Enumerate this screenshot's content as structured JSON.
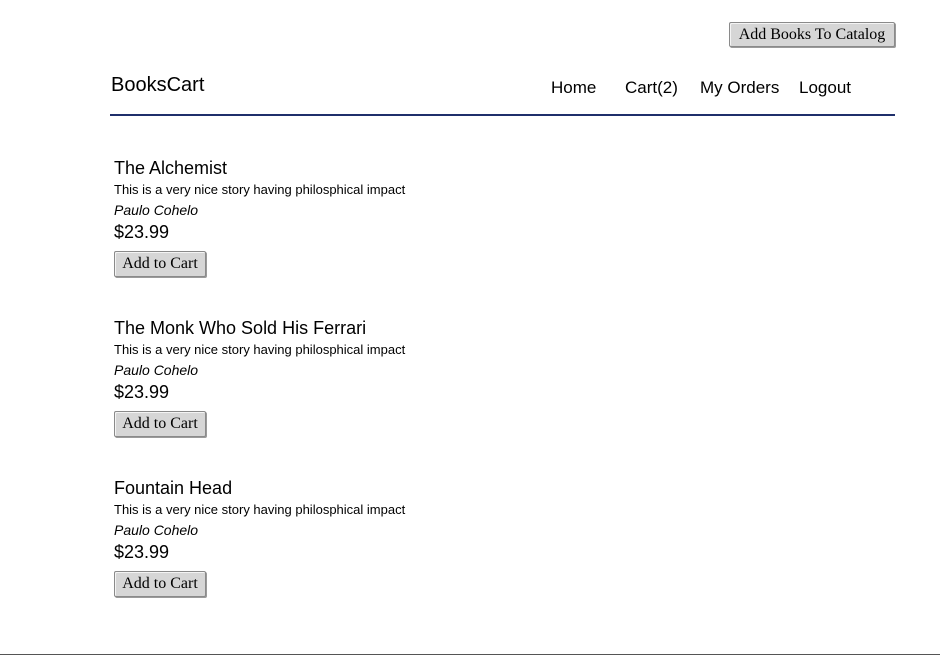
{
  "admin": {
    "add_books_label": "Add Books To Catalog"
  },
  "header": {
    "brand": "BooksCart",
    "nav": {
      "home": "Home",
      "cart": "Cart(2)",
      "orders": "My Orders",
      "logout": "Logout"
    }
  },
  "books": [
    {
      "title": "The Alchemist",
      "description": "This is a very nice story having philosphical impact",
      "author": "Paulo Cohelo",
      "price": "$23.99",
      "add_label": "Add to Cart"
    },
    {
      "title": "The Monk Who Sold His Ferrari",
      "description": "This is a very nice story having philosphical impact",
      "author": "Paulo Cohelo",
      "price": "$23.99",
      "add_label": "Add to Cart"
    },
    {
      "title": "Fountain Head",
      "description": "This is a very nice story having philosphical impact",
      "author": "Paulo Cohelo",
      "price": "$23.99",
      "add_label": "Add to Cart"
    }
  ]
}
